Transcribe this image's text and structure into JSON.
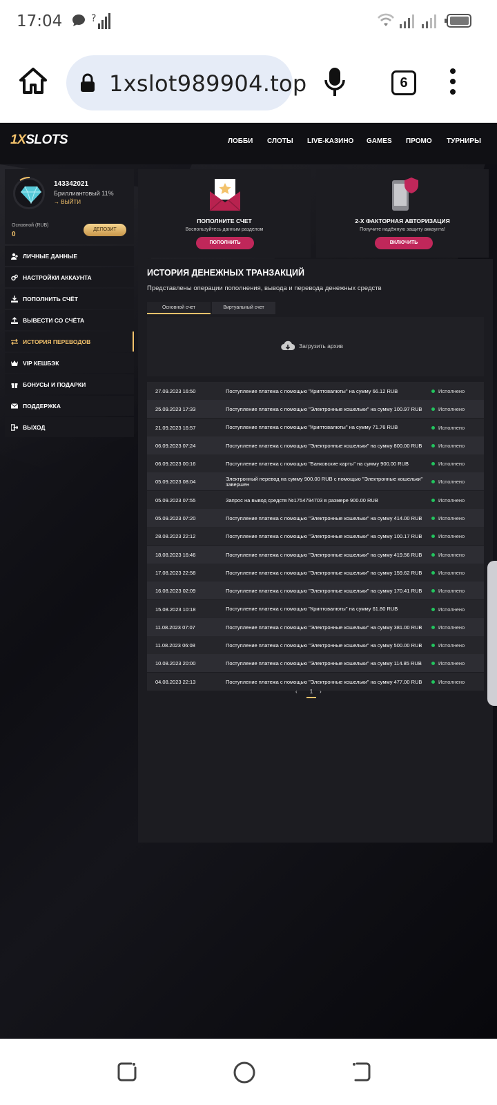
{
  "status": {
    "time": "17:04",
    "battery_level": 0.9
  },
  "browser": {
    "url": "1xslot989904.top",
    "tab_count": "6"
  },
  "site": {
    "logo": {
      "part1": "1X",
      "part2": "SLOTS"
    },
    "nav": [
      "ЛОББИ",
      "СЛОТЫ",
      "LIVE-КАЗИНО",
      "GAMES",
      "ПРОМО",
      "ТУРНИРЫ"
    ],
    "profile": {
      "id": "143342021",
      "level": "Бриллиантовый 11%",
      "logout": "ВЫЙТИ",
      "balance_label": "Основной (RUB)",
      "balance_value": "0",
      "deposit_button": "ДЕПОЗИТ"
    },
    "menu": [
      {
        "label": "ЛИЧНЫЕ ДАННЫЕ",
        "icon": "user-plus-icon"
      },
      {
        "label": "НАСТРОЙКИ АККАУНТА",
        "icon": "gears-icon"
      },
      {
        "label": "ПОПОЛНИТЬ СЧЁТ",
        "icon": "download-icon"
      },
      {
        "label": "ВЫВЕСТИ СО СЧЁТА",
        "icon": "upload-icon"
      },
      {
        "label": "ИСТОРИЯ ПЕРЕВОДОВ",
        "icon": "transfer-icon"
      },
      {
        "label": "VIP КЕШБЭК",
        "icon": "crown-icon"
      },
      {
        "label": "БОНУСЫ И ПОДАРКИ",
        "icon": "gift-icon"
      },
      {
        "label": "ПОДДЕРЖКА",
        "icon": "envelope-icon"
      },
      {
        "label": "ВЫХОД",
        "icon": "exit-icon"
      }
    ],
    "card_deposit": {
      "title": "ПОПОЛНИТЕ СЧЕТ",
      "subtitle": "Воспользуйтесь данным разделом",
      "button": "ПОПОЛНИТЬ"
    },
    "card_2fa": {
      "title": "2-Х ФАКТОРНАЯ АВТОРИЗАЦИЯ",
      "subtitle": "Получите надёжную защиту аккаунта!",
      "button": "ВКЛЮЧИТЬ"
    },
    "transactions": {
      "title": "ИСТОРИЯ ДЕНЕЖНЫХ ТРАНЗАКЦИЙ",
      "subtitle": "Представлены операции пополнения, вывода и перевода денежных средств",
      "tabs": [
        "Основной счет",
        "Виртуальный счет"
      ],
      "archive": "Загрузить архив",
      "rows": [
        {
          "date": "27.09.2023 16:50",
          "desc": "Поступление платежа с помощью \"Криптовалюты\" на сумму 66.12 RUB",
          "status": "Исполнено"
        },
        {
          "date": "25.09.2023 17:33",
          "desc": "Поступление платежа с помощью \"Электронные кошельки\" на сумму 100.97 RUB",
          "status": "Исполнено"
        },
        {
          "date": "21.09.2023 16:57",
          "desc": "Поступление платежа с помощью \"Криптовалюты\" на сумму 71.76 RUB",
          "status": "Исполнено"
        },
        {
          "date": "06.09.2023 07:24",
          "desc": "Поступление платежа с помощью \"Электронные кошельки\" на сумму 800.00 RUB",
          "status": "Исполнено"
        },
        {
          "date": "06.09.2023 00:16",
          "desc": "Поступление платежа с помощью \"Банковские карты\" на сумму 900.00 RUB",
          "status": "Исполнено"
        },
        {
          "date": "05.09.2023 08:04",
          "desc": "Электронный перевод на сумму 900.00 RUB с помощью \"Электронные кошельки\" завершен",
          "status": "Исполнено"
        },
        {
          "date": "05.09.2023 07:55",
          "desc": "Запрос на вывод средств №1754794703 в размере 900.00 RUB",
          "status": "Исполнено"
        },
        {
          "date": "05.09.2023 07:20",
          "desc": "Поступление платежа с помощью \"Электронные кошельки\" на сумму 414.00 RUB",
          "status": "Исполнено"
        },
        {
          "date": "28.08.2023 22:12",
          "desc": "Поступление платежа с помощью \"Электронные кошельки\" на сумму 100.17 RUB",
          "status": "Исполнено"
        },
        {
          "date": "18.08.2023 16:46",
          "desc": "Поступление платежа с помощью \"Электронные кошельки\" на сумму 419.56 RUB",
          "status": "Исполнено"
        },
        {
          "date": "17.08.2023 22:58",
          "desc": "Поступление платежа с помощью \"Электронные кошельки\" на сумму 159.62 RUB",
          "status": "Исполнено"
        },
        {
          "date": "16.08.2023 02:09",
          "desc": "Поступление платежа с помощью \"Электронные кошельки\" на сумму 170.41 RUB",
          "status": "Исполнено"
        },
        {
          "date": "15.08.2023 10:18",
          "desc": "Поступление платежа с помощью \"Криптовалюты\" на сумму 61.80 RUB",
          "status": "Исполнено"
        },
        {
          "date": "11.08.2023 07:07",
          "desc": "Поступление платежа с помощью \"Электронные кошельки\" на сумму 381.00 RUB",
          "status": "Исполнено"
        },
        {
          "date": "11.08.2023 06:08",
          "desc": "Поступление платежа с помощью \"Электронные кошельки\" на сумму 500.00 RUB",
          "status": "Исполнено"
        },
        {
          "date": "10.08.2023 20:00",
          "desc": "Поступление платежа с помощью \"Электронные кошельки\" на сумму 114.85 RUB",
          "status": "Исполнено"
        },
        {
          "date": "04.08.2023 22:13",
          "desc": "Поступление платежа с помощью \"Электронные кошельки\" на сумму 477.00 RUB",
          "status": "Исполнено"
        }
      ],
      "pager": {
        "prev": "‹",
        "current": "1",
        "next": "›"
      }
    }
  },
  "colors": {
    "accent": "#f3c26b",
    "button": "#c0275a",
    "status_ok": "#22c55e"
  }
}
